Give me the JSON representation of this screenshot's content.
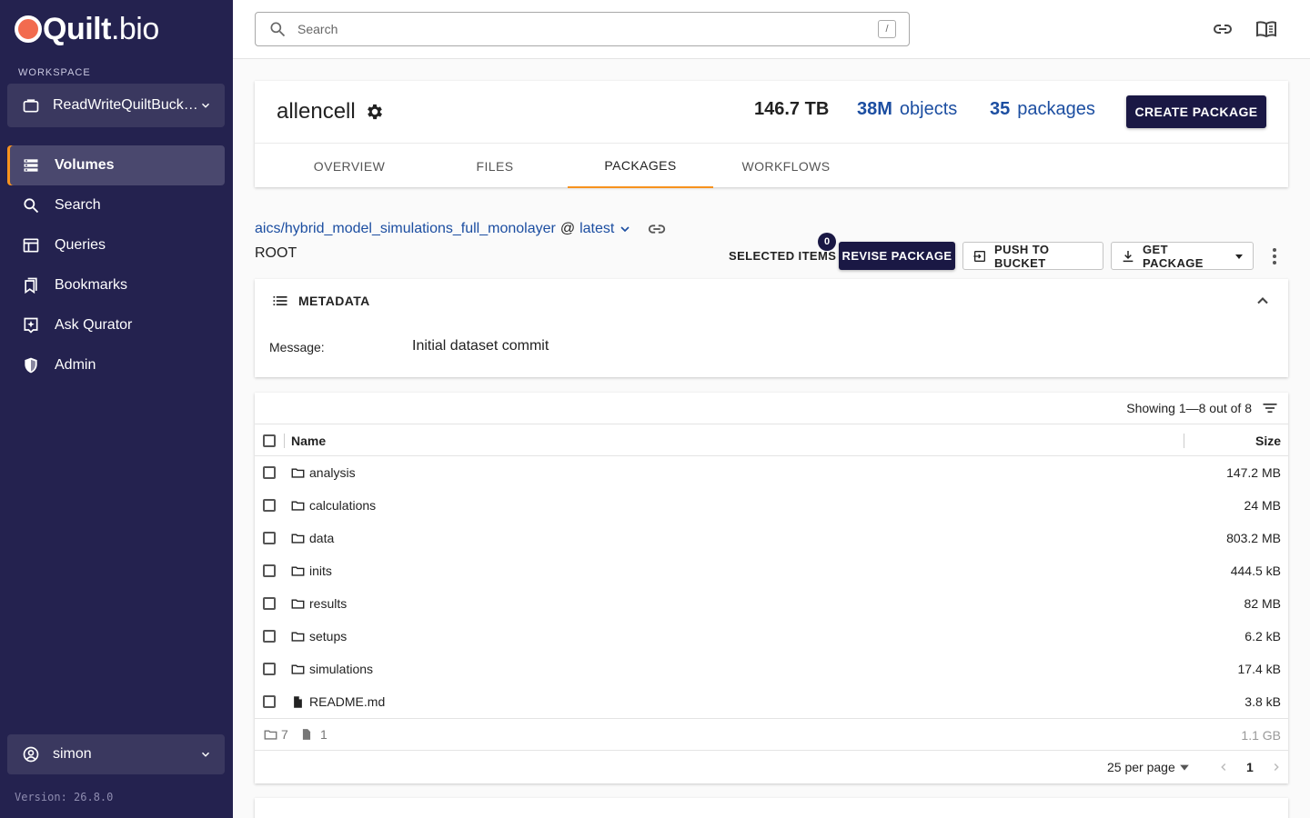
{
  "brand": {
    "part1": "Quilt",
    "part2": ".bio"
  },
  "sidebar": {
    "workspace_label": "WORKSPACE",
    "workspace_value": "ReadWriteQuiltBuck…",
    "items": [
      {
        "label": "Volumes",
        "icon": "volumes-icon"
      },
      {
        "label": "Search",
        "icon": "search-icon"
      },
      {
        "label": "Queries",
        "icon": "table-icon"
      },
      {
        "label": "Bookmarks",
        "icon": "bookmarks-icon"
      },
      {
        "label": "Ask Qurator",
        "icon": "assistant-icon"
      },
      {
        "label": "Admin",
        "icon": "shield-icon"
      }
    ],
    "active_item": "Volumes",
    "user": "simon",
    "version": "Version: 26.8.0"
  },
  "topbar": {
    "search_placeholder": "Search",
    "search_shortcut": "/"
  },
  "bucket": {
    "name": "allencell",
    "size": "146.7 TB",
    "objects_count": "38M",
    "objects_label": "objects",
    "packages_count": "35",
    "packages_label": "packages",
    "create_label": "CREATE PACKAGE",
    "tabs": [
      "OVERVIEW",
      "FILES",
      "PACKAGES",
      "WORKFLOWS"
    ],
    "active_tab": "PACKAGES"
  },
  "package": {
    "path": "aics/hybrid_model_simulations_full_monolayer",
    "at": "@",
    "revision": "latest",
    "root_label": "ROOT",
    "selected_label": "SELECTED ITEMS",
    "selected_count": "0",
    "revise_label": "REVISE PACKAGE",
    "push_label": "PUSH TO BUCKET",
    "get_label": "GET PACKAGE"
  },
  "metadata": {
    "title": "METADATA",
    "message_key": "Message:",
    "message_value": "Initial dataset commit"
  },
  "files": {
    "showing": "Showing 1—8 out of 8",
    "columns": {
      "name": "Name",
      "size": "Size"
    },
    "rows": [
      {
        "name": "analysis",
        "size": "147.2 MB",
        "kind": "folder"
      },
      {
        "name": "calculations",
        "size": "24 MB",
        "kind": "folder"
      },
      {
        "name": "data",
        "size": "803.2 MB",
        "kind": "folder"
      },
      {
        "name": "inits",
        "size": "444.5 kB",
        "kind": "folder"
      },
      {
        "name": "results",
        "size": "82 MB",
        "kind": "folder"
      },
      {
        "name": "setups",
        "size": "6.2 kB",
        "kind": "folder"
      },
      {
        "name": "simulations",
        "size": "17.4 kB",
        "kind": "folder"
      },
      {
        "name": "README.md",
        "size": "3.8 kB",
        "kind": "file"
      }
    ],
    "summary": {
      "folders": "7",
      "files": "1",
      "total": "1.1 GB"
    },
    "per_page": "25 per page",
    "page": "1"
  },
  "colors": {
    "sidebar_bg": "#24224f",
    "accent_orange": "#f7921e",
    "link_blue": "#1c4ea1",
    "button_dark": "#1a1844"
  }
}
